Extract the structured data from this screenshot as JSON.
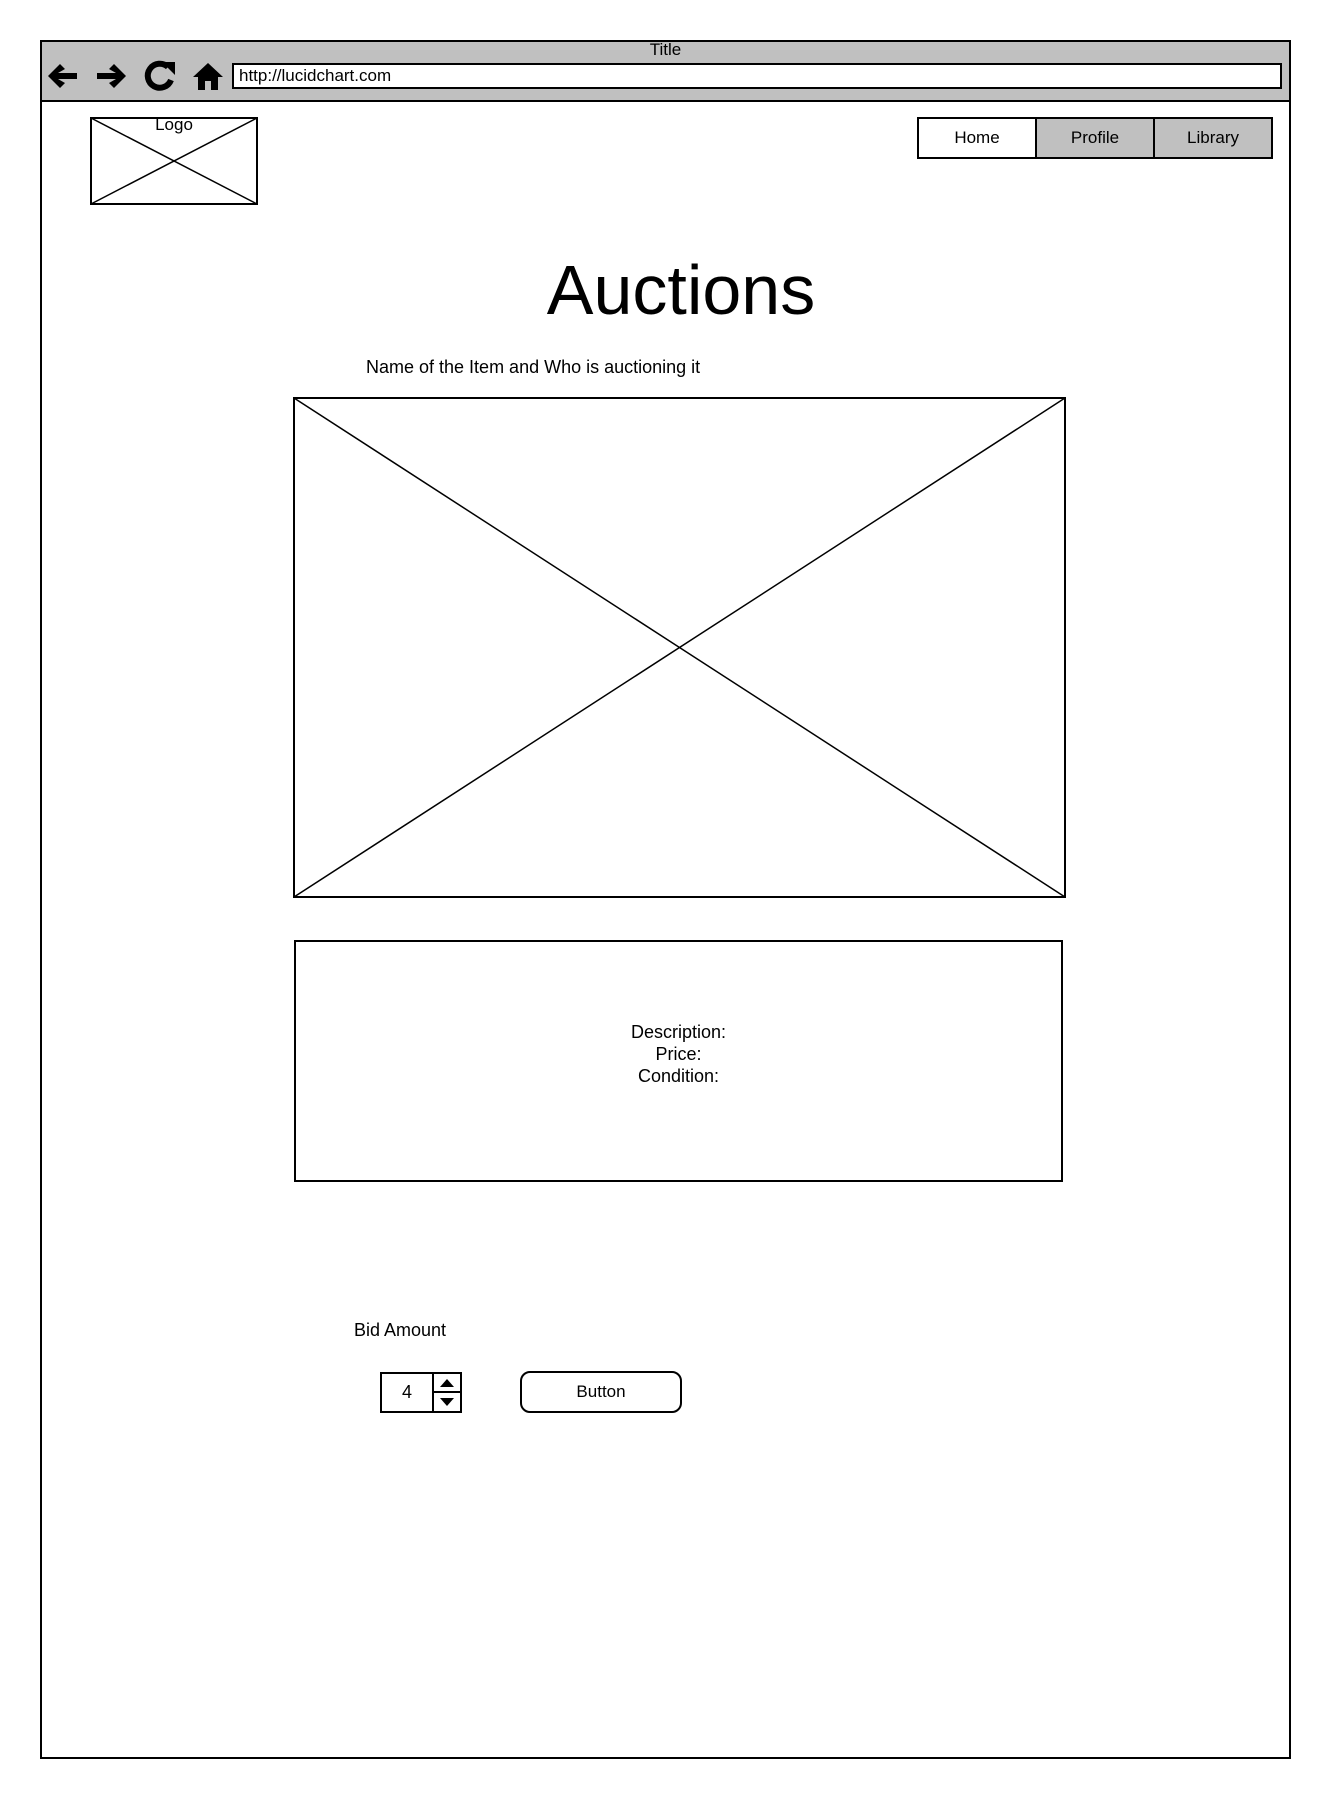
{
  "browser": {
    "window_title": "Title",
    "url": "http://lucidchart.com",
    "nav_icons": [
      "back-arrow-icon",
      "forward-arrow-icon",
      "reload-icon",
      "home-icon"
    ]
  },
  "header": {
    "logo_label": "Logo",
    "nav_tabs": [
      {
        "label": "Home",
        "active": true
      },
      {
        "label": "Profile",
        "active": false
      },
      {
        "label": "Library",
        "active": false
      }
    ]
  },
  "main": {
    "title": "Auctions",
    "item_name": "Name of the Item and Who is auctioning it",
    "details": {
      "description_label": "Description:",
      "price_label": "Price:",
      "condition_label": "Condition:"
    },
    "bid": {
      "label": "Bid Amount",
      "value": "4",
      "button_label": "Button"
    }
  },
  "colors": {
    "chrome_gray": "#c0c0c0",
    "border": "#000000",
    "background": "#ffffff"
  }
}
